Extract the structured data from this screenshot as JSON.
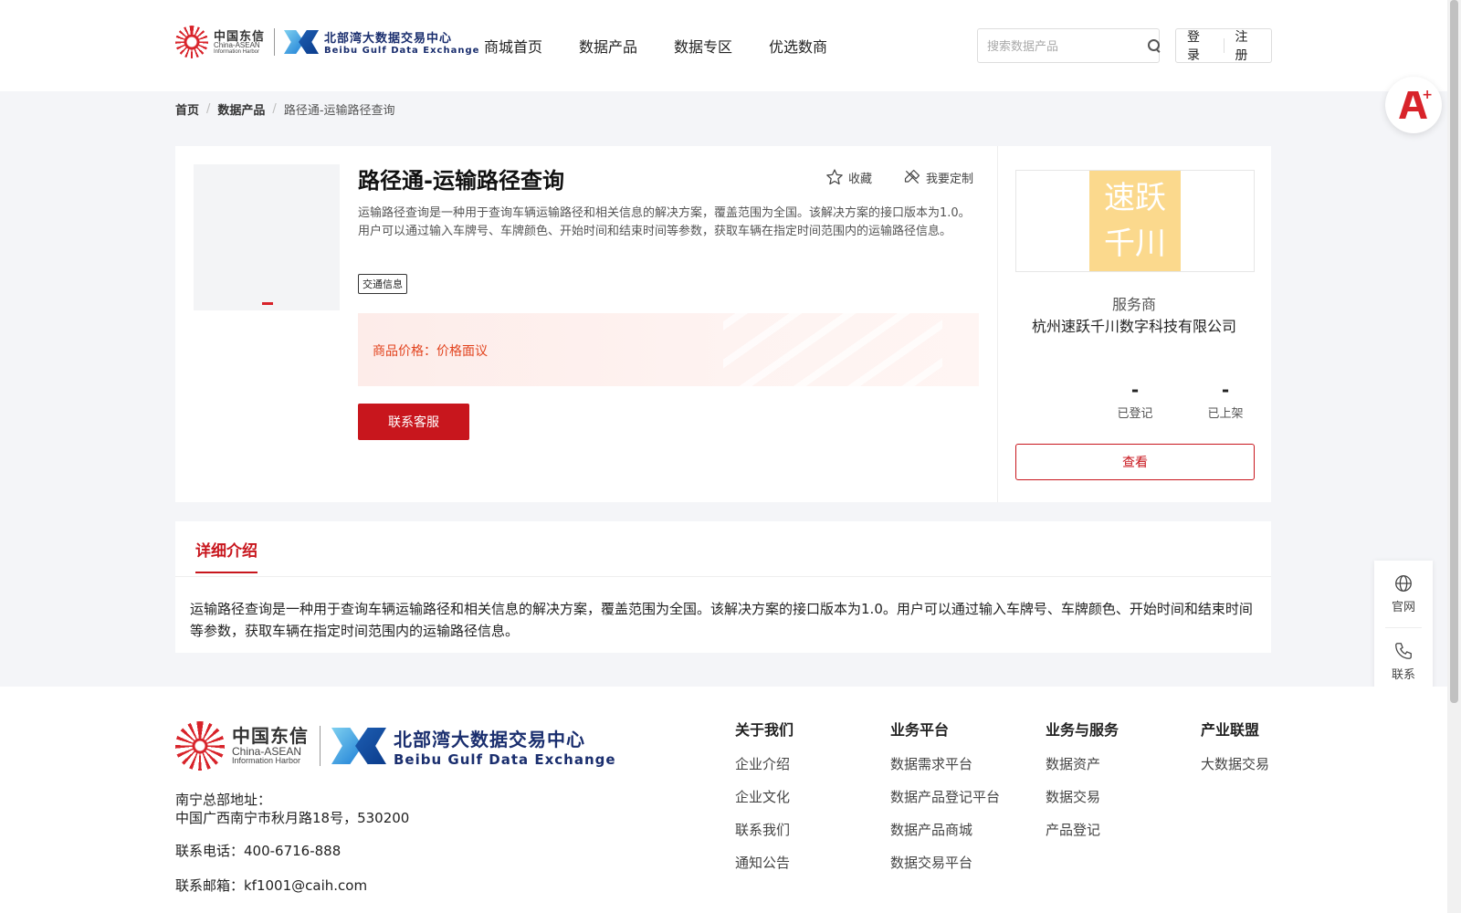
{
  "header": {
    "logo_cn": {
      "line1": "中国东信",
      "line2": "China-ASEAN",
      "line3": "Information Harbor"
    },
    "logo_bb": {
      "line1": "北部湾大数据交易中心",
      "line2": "Beibu Gulf Data Exchange"
    },
    "nav": [
      "商城首页",
      "数据产品",
      "数据专区",
      "优选数商"
    ],
    "search_placeholder": "搜索数据产品",
    "login": "登录",
    "register": "注册"
  },
  "breadcrumb": [
    "首页",
    "数据产品",
    "路径通-运输路径查询"
  ],
  "product": {
    "title": "路径通-运输路径查询",
    "favorite": "收藏",
    "customize": "我要定制",
    "description": "运输路径查询是一种用于查询车辆运输路径和相关信息的解决方案，覆盖范围为全国。该解决方案的接口版本为1.0。用户可以通过输入车牌号、车牌颜色、开始时间和结束时间等参数，获取车辆在指定时间范围内的运输路径信息。",
    "tag": "交通信息",
    "price_label": "商品价格：价格面议",
    "contact_button": "联系客服"
  },
  "vendor": {
    "logo_text_1": "速跃",
    "logo_text_2": "千川",
    "label": "服务商",
    "name": "杭州速跃千川数字科技有限公司",
    "registered_value": "-",
    "registered_label": "已登记",
    "listed_value": "-",
    "listed_label": "已上架",
    "view_button": "查看"
  },
  "detail": {
    "tab": "详细介绍",
    "body": "运输路径查询是一种用于查询车辆运输路径和相关信息的解决方案，覆盖范围为全国。该解决方案的接口版本为1.0。用户可以通过输入车牌号、车牌颜色、开始时间和结束时间等参数，获取车辆在指定时间范围内的运输路径信息。"
  },
  "side_tools": {
    "website": "官网",
    "contact": "联系"
  },
  "footer": {
    "address_label": "南宁总部地址：",
    "address": "中国广西南宁市秋月路18号，530200",
    "phone": "联系电话：400-6716-888",
    "email": "联系邮箱：kf1001@caih.com",
    "columns": [
      {
        "title": "关于我们",
        "items": [
          "企业介绍",
          "企业文化",
          "联系我们",
          "通知公告"
        ]
      },
      {
        "title": "业务平台",
        "items": [
          "数据需求平台",
          "数据产品登记平台",
          "数据产品商城",
          "数据交易平台"
        ]
      },
      {
        "title": "业务与服务",
        "items": [
          "数据资产",
          "数据交易",
          "产品登记"
        ]
      },
      {
        "title": "产业联盟",
        "items": [
          "大数据交易"
        ]
      }
    ]
  },
  "colors": {
    "brand_red": "#c8161d",
    "price_orange": "#e2431e",
    "vendor_logo_bg": "#fbd98d"
  }
}
